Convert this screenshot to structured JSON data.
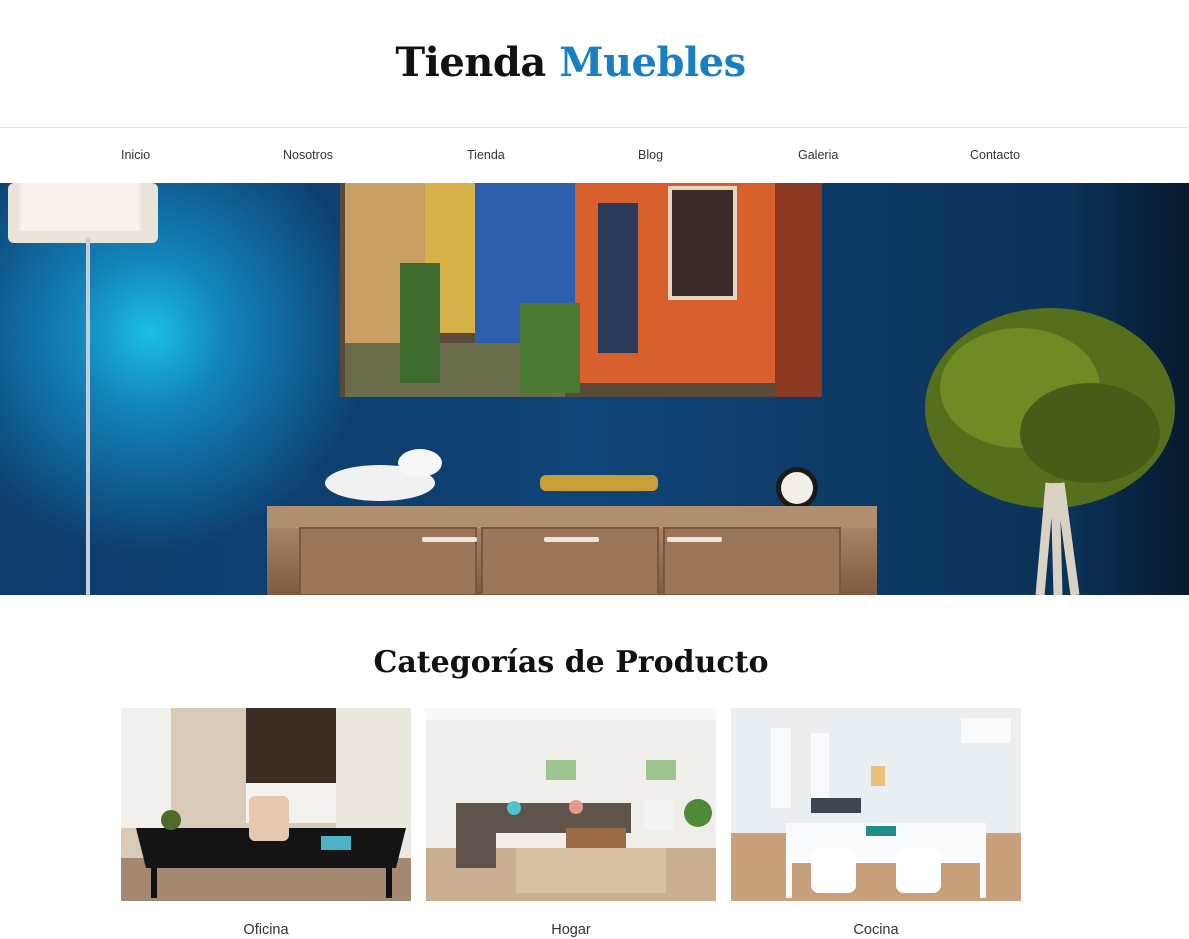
{
  "header": {
    "logo_part1": "Tienda",
    "logo_part2": "Muebles"
  },
  "nav": {
    "items": [
      {
        "label": "Inicio"
      },
      {
        "label": "Nosotros"
      },
      {
        "label": "Tienda"
      },
      {
        "label": "Blog"
      },
      {
        "label": "Galeria"
      },
      {
        "label": "Contacto"
      }
    ]
  },
  "categories": {
    "title": "Categorías de Producto",
    "items": [
      {
        "label": "Oficina"
      },
      {
        "label": "Hogar"
      },
      {
        "label": "Cocina"
      }
    ]
  },
  "colors": {
    "accent": "#1a7fc0",
    "hero_wall": "#0f3e6e"
  }
}
